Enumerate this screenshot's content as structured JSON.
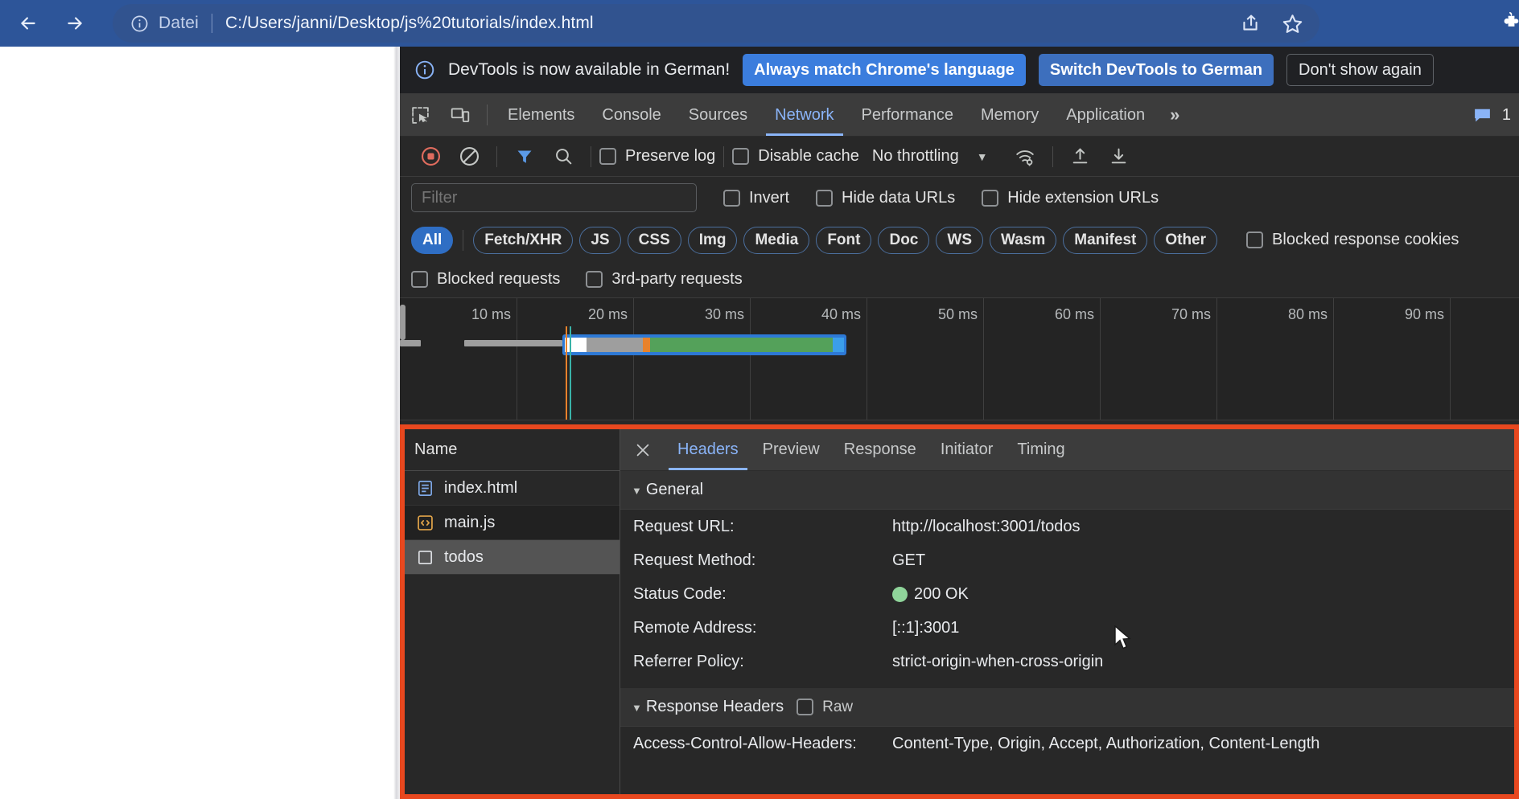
{
  "browser": {
    "back_icon": "arrow-left-icon",
    "forward_icon": "arrow-right-icon",
    "reload_icon": "reload-icon",
    "info_icon": "info-circle-icon",
    "scheme_label": "Datei",
    "url": "C:/Users/janni/Desktop/js%20tutorials/index.html",
    "share_icon": "share-icon",
    "bookmark_icon": "star-icon",
    "extensions_icon": "puzzle-piece-icon",
    "accent_color": "#2d5599"
  },
  "devtools": {
    "banner": {
      "info_icon": "info-circle-icon",
      "message": "DevTools is now available in German!",
      "primary_button": "Always match Chrome's language",
      "secondary_button": "Switch DevTools to German",
      "dismiss_button": "Don't show again"
    },
    "tabs": {
      "inspect_icon": "inspect-element-icon",
      "device_icon": "device-toolbar-icon",
      "items": [
        {
          "label": "Elements",
          "active": false
        },
        {
          "label": "Console",
          "active": false
        },
        {
          "label": "Sources",
          "active": false
        },
        {
          "label": "Network",
          "active": true
        },
        {
          "label": "Performance",
          "active": false
        },
        {
          "label": "Memory",
          "active": false
        },
        {
          "label": "Application",
          "active": false
        }
      ],
      "more_tabs": "»",
      "message_icon": "message-icon",
      "message_count": "1",
      "active_color": "#8ab4f8"
    },
    "toolbar": {
      "record_icon": "record-stop-icon",
      "clear_icon": "clear-ban-icon",
      "filter_icon": "funnel-filter-icon",
      "search_icon": "search-icon",
      "preserve_log_label": "Preserve log",
      "disable_cache_label": "Disable cache",
      "throttling_value": "No throttling",
      "throttling_caret": "▼",
      "network_conditions_icon": "wifi-settings-icon",
      "import_icon": "upload-arrow-icon",
      "export_icon": "download-arrow-icon"
    },
    "filter_bar": {
      "input_value": "",
      "input_placeholder": "Filter",
      "invert_label": "Invert",
      "hide_data_urls_label": "Hide data URLs",
      "hide_extension_urls_label": "Hide extension URLs"
    },
    "type_filters": [
      {
        "label": "All",
        "active": true
      },
      {
        "label": "Fetch/XHR",
        "active": false
      },
      {
        "label": "JS",
        "active": false
      },
      {
        "label": "CSS",
        "active": false
      },
      {
        "label": "Img",
        "active": false
      },
      {
        "label": "Media",
        "active": false
      },
      {
        "label": "Font",
        "active": false
      },
      {
        "label": "Doc",
        "active": false
      },
      {
        "label": "WS",
        "active": false
      },
      {
        "label": "Wasm",
        "active": false
      },
      {
        "label": "Manifest",
        "active": false
      },
      {
        "label": "Other",
        "active": false
      }
    ],
    "cookie_filter_label": "Blocked response cookies",
    "blocked_requests_label": "Blocked requests",
    "third_party_label": "3rd-party requests",
    "overview": {
      "tick_labels": [
        "10 ms",
        "20 ms",
        "30 ms",
        "40 ms",
        "50 ms",
        "60 ms",
        "70 ms",
        "80 ms",
        "90 ms"
      ],
      "selection_color": "#2d79d6",
      "segment_colors": {
        "queue": "#ffffff",
        "stalled": "#9e9e9e",
        "ttfb": "#e8822b",
        "download": "#54a15a",
        "end": "#3b9eea"
      }
    },
    "requests": {
      "column_header": "Name",
      "rows": [
        {
          "name": "index.html",
          "icon": "document-html-icon",
          "selected": false
        },
        {
          "name": "main.js",
          "icon": "code-js-icon",
          "selected": false
        },
        {
          "name": "todos",
          "icon": "xhr-square-icon",
          "selected": true
        }
      ]
    },
    "detail": {
      "close_icon": "close-x-icon",
      "tabs": [
        {
          "label": "Headers",
          "active": true
        },
        {
          "label": "Preview",
          "active": false
        },
        {
          "label": "Response",
          "active": false
        },
        {
          "label": "Initiator",
          "active": false
        },
        {
          "label": "Timing",
          "active": false
        }
      ],
      "general_section": {
        "title": "General",
        "caret": "▼",
        "rows": [
          {
            "key": "Request URL:",
            "value": "http://localhost:3001/todos",
            "dot": false
          },
          {
            "key": "Request Method:",
            "value": "GET",
            "dot": false
          },
          {
            "key": "Status Code:",
            "value": "200 OK",
            "dot": true
          },
          {
            "key": "Remote Address:",
            "value": "[::1]:3001",
            "dot": false
          },
          {
            "key": "Referrer Policy:",
            "value": "strict-origin-when-cross-origin",
            "dot": false
          }
        ]
      },
      "response_section": {
        "title": "Response Headers",
        "caret": "▼",
        "raw_label": "Raw",
        "rows": [
          {
            "key": "Access-Control-Allow-Headers:",
            "value": "Content-Type, Origin, Accept, Authorization, Content-Length"
          }
        ]
      },
      "status_dot_color": "#8fd49a"
    },
    "highlight_border_color": "#e8481f"
  }
}
